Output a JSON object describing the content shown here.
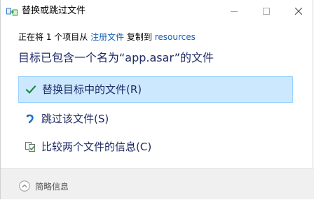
{
  "window": {
    "title": "替换或跳过文件",
    "controls": {
      "minimize": "minimize",
      "maximize": "maximize",
      "close": "close"
    }
  },
  "info": {
    "prefix": "正在将 1 个项目从 ",
    "source": "注册文件",
    "middle": " 复制到 ",
    "destination": "resources"
  },
  "heading": "目标已包含一个名为“app.asar”的文件",
  "options": [
    {
      "label": "替换目标中的文件(R)",
      "icon": "checkmark-icon",
      "selected": true
    },
    {
      "label": "跳过该文件(S)",
      "icon": "skip-arrow-icon",
      "selected": false
    },
    {
      "label": "比较两个文件的信息(C)",
      "icon": "compare-files-icon",
      "selected": false
    }
  ],
  "footer": {
    "label": "简略信息",
    "icon": "chevron-up-circle-icon"
  },
  "colors": {
    "accent": "#1a5fb4",
    "selected_bg": "#cce8ff",
    "selected_border": "#99d1ff",
    "check_green": "#1e8a3c",
    "skip_blue": "#1f6fc9"
  }
}
